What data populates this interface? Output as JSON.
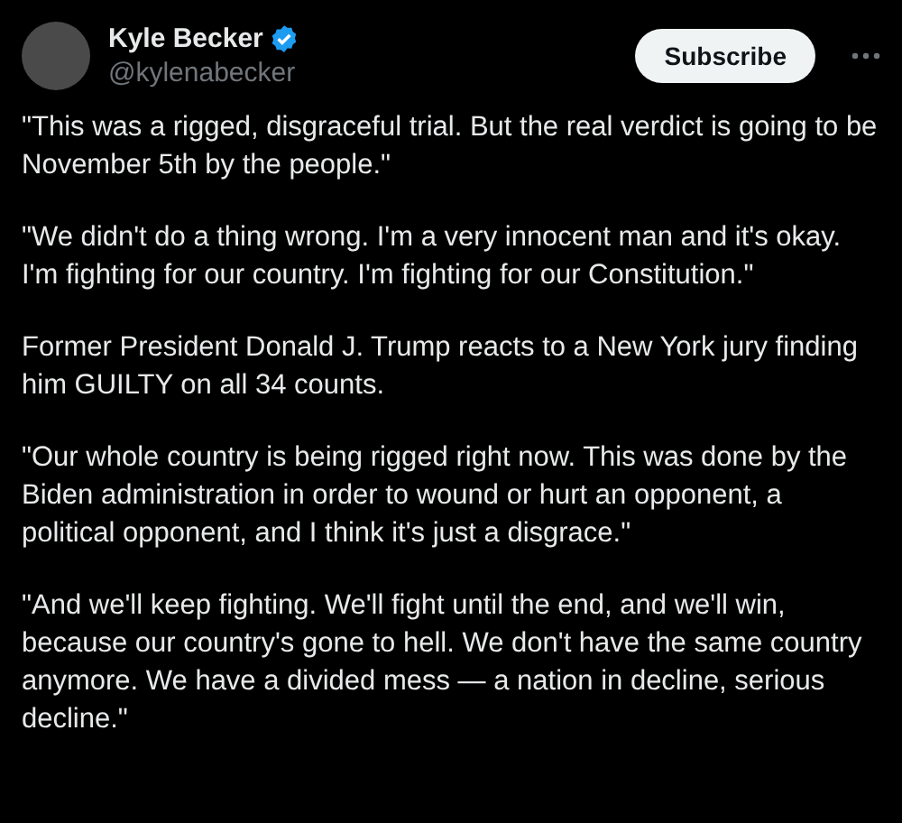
{
  "author": {
    "name": "Kyle Becker",
    "handle": "@kylenabecker",
    "verified": true
  },
  "subscribe_button": "Subscribe",
  "paragraphs": [
    "\"This was a rigged, disgraceful trial. But the real verdict is going to be November 5th by the people.\"",
    "\"We didn't do a thing wrong. I'm a very innocent man and it's okay. I'm fighting for our country. I'm fighting for our Constitution.\"",
    "Former President Donald J. Trump reacts to a New York jury finding him GUILTY on all 34 counts.",
    "\"Our whole country is being rigged right now. This was done by the Biden administration in order to wound or hurt an opponent, a political opponent, and I think it's just a disgrace.\"",
    "\"And we'll keep fighting. We'll fight until the end, and we'll win, because our country's gone to hell. We don't have the same country anymore. We have a divided mess — a nation in decline, serious decline.\""
  ]
}
